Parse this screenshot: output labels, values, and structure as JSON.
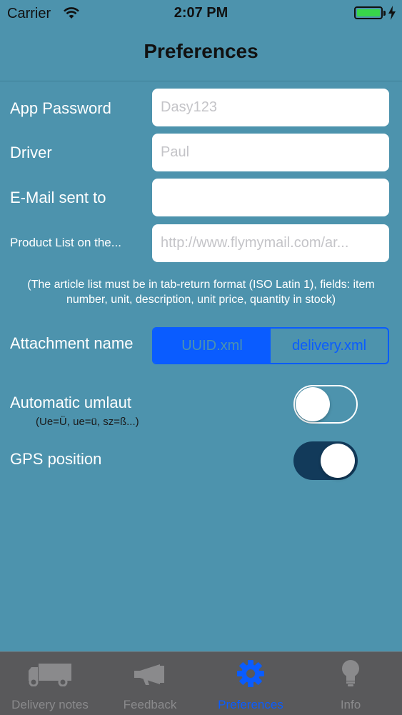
{
  "status_bar": {
    "carrier": "Carrier",
    "time": "2:07 PM",
    "battery_level": 1.0,
    "charging": true
  },
  "nav": {
    "title": "Preferences"
  },
  "form": {
    "app_password": {
      "label": "App Password",
      "placeholder": "Dasy123",
      "value": ""
    },
    "driver": {
      "label": "Driver",
      "placeholder": "Paul",
      "value": ""
    },
    "email": {
      "label": "E-Mail sent to",
      "placeholder": "",
      "value": ""
    },
    "product_list": {
      "label": "Product List on the...",
      "placeholder": "http://www.flymymail.com/ar...",
      "value": ""
    },
    "note": "(The article list must be in tab-return format (ISO Latin 1), fields: item number, unit, description, unit price, quantity in stock)",
    "attachment": {
      "label": "Attachment name",
      "options": [
        "UUID.xml",
        "delivery.xml"
      ],
      "selected": "UUID.xml"
    },
    "umlaut": {
      "label": "Automatic umlaut",
      "sublabel": "(Ue=Ü, ue=ü, sz=ß...)",
      "on": false
    },
    "gps": {
      "label": "GPS position",
      "on": true
    }
  },
  "tabbar": {
    "tabs": [
      {
        "label": "Delivery notes",
        "icon": "truck-icon",
        "active": false
      },
      {
        "label": "Feedback",
        "icon": "megaphone-icon",
        "active": false
      },
      {
        "label": "Preferences",
        "icon": "gear-icon",
        "active": true
      },
      {
        "label": "Info",
        "icon": "lightbulb-icon",
        "active": false
      }
    ]
  },
  "colors": {
    "background": "#4d93ad",
    "accent": "#0a5cff",
    "toggle_on": "#123a5a",
    "tabbar": "#59595b"
  }
}
